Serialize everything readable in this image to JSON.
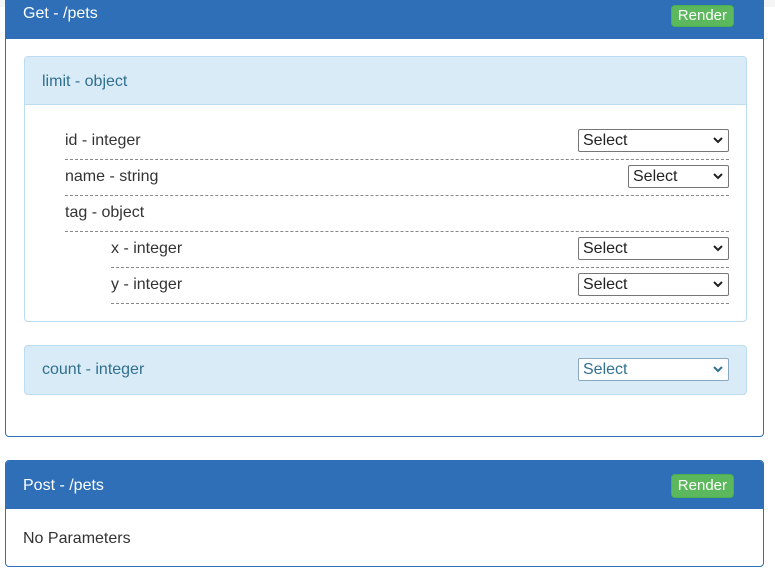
{
  "get_panel": {
    "title": "Get - /pets",
    "render_label": "Render",
    "limit_box": {
      "title": "limit - object",
      "rows": [
        {
          "label": "id - integer",
          "select": "Select"
        },
        {
          "label": "name - string",
          "select": "Select"
        },
        {
          "label": "tag - object"
        },
        {
          "label": "x - integer",
          "select": "Select"
        },
        {
          "label": "y - integer",
          "select": "Select"
        }
      ]
    },
    "count_box": {
      "title": "count - integer",
      "select": "Select"
    }
  },
  "post_panel": {
    "title": "Post - /pets",
    "render_label": "Render",
    "body_text": "No Parameters"
  },
  "colors": {
    "panel_heading": "#2e6fb7",
    "render_button": "#5cb85c",
    "param_header": "#d9ebf7",
    "param_title": "#31708f"
  },
  "icons": {
    "select_arrow": "chevron-down-icon"
  }
}
